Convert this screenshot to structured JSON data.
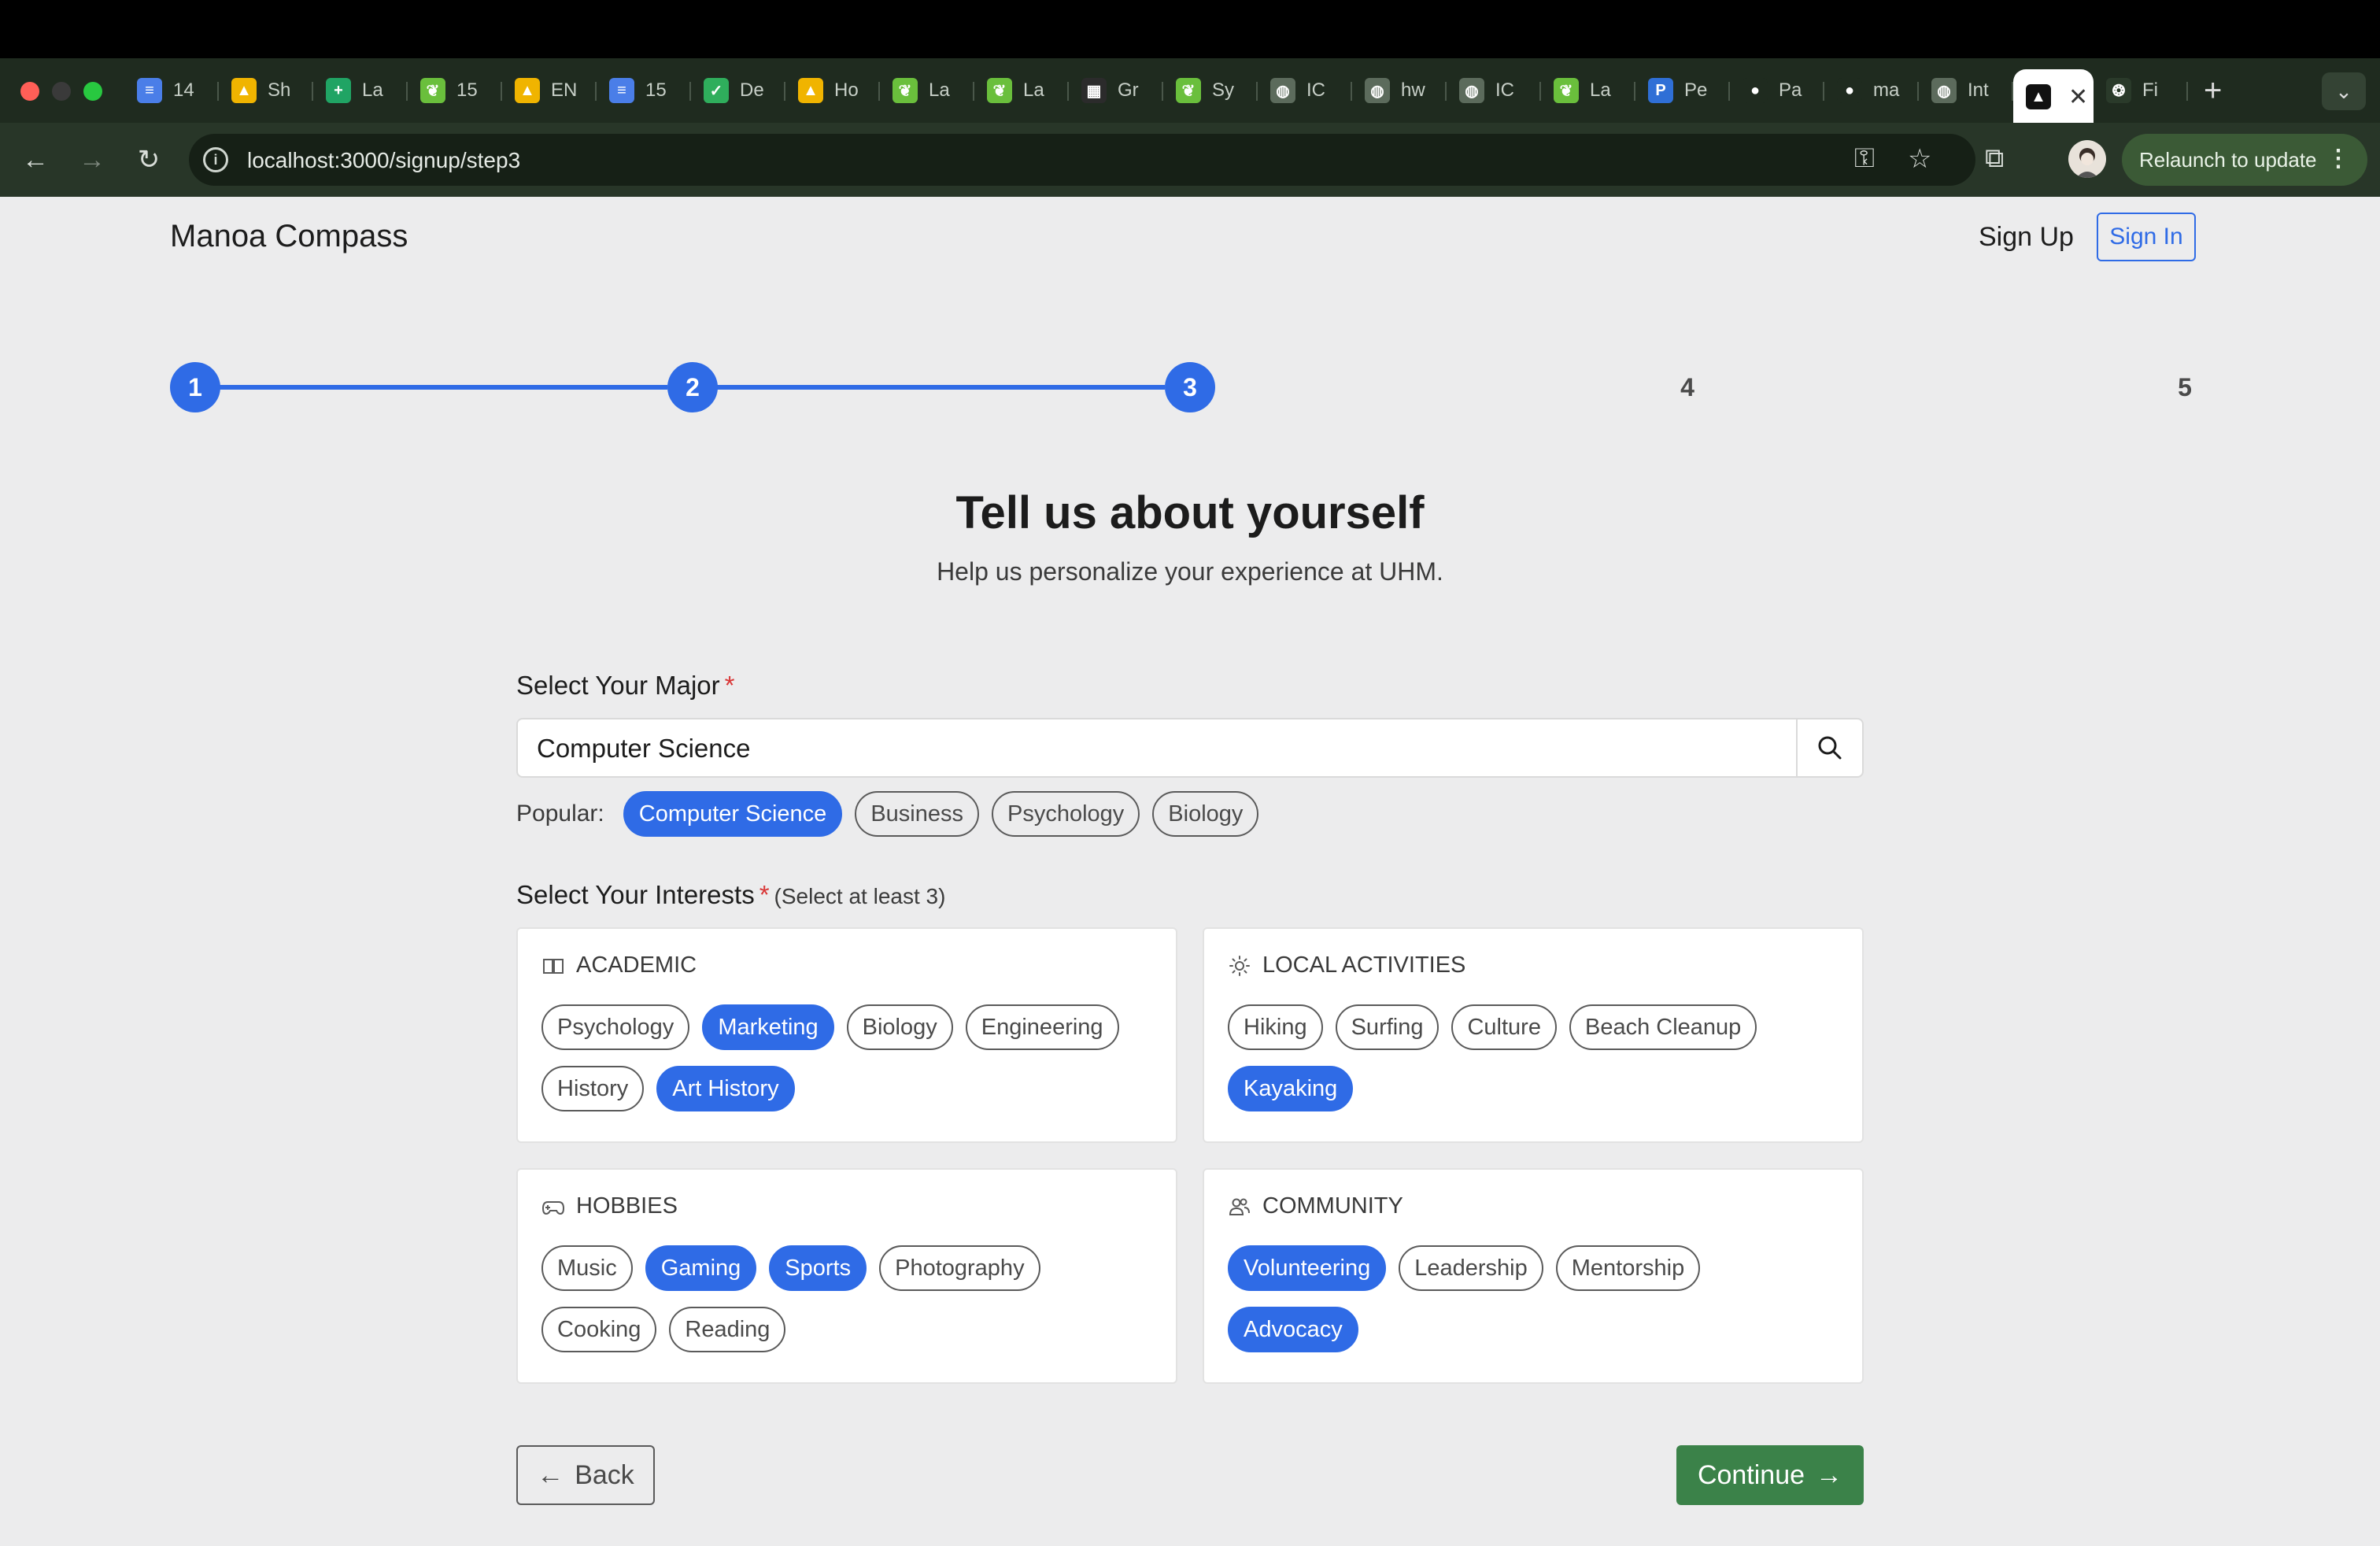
{
  "browser": {
    "tabs": [
      {
        "label": "14",
        "color": "#4a7ee8",
        "glyph": "≡"
      },
      {
        "label": "Sh",
        "color": "#f0b400",
        "glyph": "▲"
      },
      {
        "label": "La",
        "color": "#20a464",
        "glyph": "+"
      },
      {
        "label": "15",
        "color": "#6abf3c",
        "glyph": "❦"
      },
      {
        "label": "EN",
        "color": "#f0b400",
        "glyph": "▲"
      },
      {
        "label": "15",
        "color": "#4a7ee8",
        "glyph": "≡"
      },
      {
        "label": "De",
        "color": "#2fae5c",
        "glyph": "✓"
      },
      {
        "label": "Ho",
        "color": "#f0b400",
        "glyph": "▲"
      },
      {
        "label": "La",
        "color": "#6abf3c",
        "glyph": "❦"
      },
      {
        "label": "La",
        "color": "#6abf3c",
        "glyph": "❦"
      },
      {
        "label": "Gr",
        "color": "#2b2b2b",
        "glyph": "▦"
      },
      {
        "label": "Sy",
        "color": "#6abf3c",
        "glyph": "❦"
      },
      {
        "label": "IC",
        "color": "#5c6b5c",
        "glyph": "◍"
      },
      {
        "label": "hw",
        "color": "#5c6b5c",
        "glyph": "◍"
      },
      {
        "label": "IC",
        "color": "#5c6b5c",
        "glyph": "◍"
      },
      {
        "label": "La",
        "color": "#6abf3c",
        "glyph": "❦"
      },
      {
        "label": "Pe",
        "color": "#2f6fd6",
        "glyph": "P"
      },
      {
        "label": "Pa",
        "color": "#1f2b1f",
        "glyph": "●"
      },
      {
        "label": "ma",
        "color": "#1f2b1f",
        "glyph": "●"
      },
      {
        "label": "Int",
        "color": "#5c6b5c",
        "glyph": "◍"
      }
    ],
    "active_tab_glyph": "▲",
    "active_tab_close": "✕",
    "after_tab": {
      "label": "Fi",
      "glyph": "❂"
    },
    "new_tab": "+",
    "tab_menu": "⌄",
    "url": "localhost:3000/signup/step3",
    "relaunch_label": "Relaunch to update",
    "colors": {
      "traffic_red": "#ff5f57",
      "traffic_yellow": "#3a3a3a",
      "traffic_green": "#28c840"
    }
  },
  "header": {
    "brand": "Manoa Compass",
    "sign_up": "Sign Up",
    "sign_in": "Sign In"
  },
  "stepper": {
    "current": 3,
    "steps": [
      "1",
      "2",
      "3",
      "4",
      "5"
    ],
    "accent": "#2f6be6"
  },
  "intro": {
    "title": "Tell us about yourself",
    "subtitle": "Help us personalize your experience at UHM."
  },
  "major": {
    "label": "Select Your Major",
    "required_mark": "*",
    "value": "Computer Science",
    "popular_label": "Popular:",
    "popular": [
      {
        "label": "Computer Science",
        "selected": true
      },
      {
        "label": "Business",
        "selected": false
      },
      {
        "label": "Psychology",
        "selected": false
      },
      {
        "label": "Biology",
        "selected": false
      }
    ]
  },
  "interests": {
    "label": "Select Your Interests",
    "required_mark": "*",
    "hint": "(Select at least 3)",
    "categories": [
      {
        "title": "ACADEMIC",
        "icon": "book-icon",
        "items": [
          {
            "label": "Psychology",
            "selected": false
          },
          {
            "label": "Marketing",
            "selected": true
          },
          {
            "label": "Biology",
            "selected": false
          },
          {
            "label": "Engineering",
            "selected": false
          },
          {
            "label": "History",
            "selected": false
          },
          {
            "label": "Art History",
            "selected": true
          }
        ]
      },
      {
        "title": "LOCAL ACTIVITIES",
        "icon": "sun-icon",
        "items": [
          {
            "label": "Hiking",
            "selected": false
          },
          {
            "label": "Surfing",
            "selected": false
          },
          {
            "label": "Culture",
            "selected": false
          },
          {
            "label": "Beach Cleanup",
            "selected": false
          },
          {
            "label": "Kayaking",
            "selected": true
          }
        ]
      },
      {
        "title": "HOBBIES",
        "icon": "gamepad-icon",
        "items": [
          {
            "label": "Music",
            "selected": false
          },
          {
            "label": "Gaming",
            "selected": true
          },
          {
            "label": "Sports",
            "selected": true
          },
          {
            "label": "Photography",
            "selected": false
          },
          {
            "label": "Cooking",
            "selected": false
          },
          {
            "label": "Reading",
            "selected": false
          }
        ]
      },
      {
        "title": "COMMUNITY",
        "icon": "users-icon",
        "items": [
          {
            "label": "Volunteering",
            "selected": true
          },
          {
            "label": "Leadership",
            "selected": false
          },
          {
            "label": "Mentorship",
            "selected": false
          },
          {
            "label": "Advocacy",
            "selected": true
          }
        ]
      }
    ]
  },
  "footer": {
    "back": "Back",
    "continue": "Continue",
    "continue_color": "#3b8249"
  }
}
